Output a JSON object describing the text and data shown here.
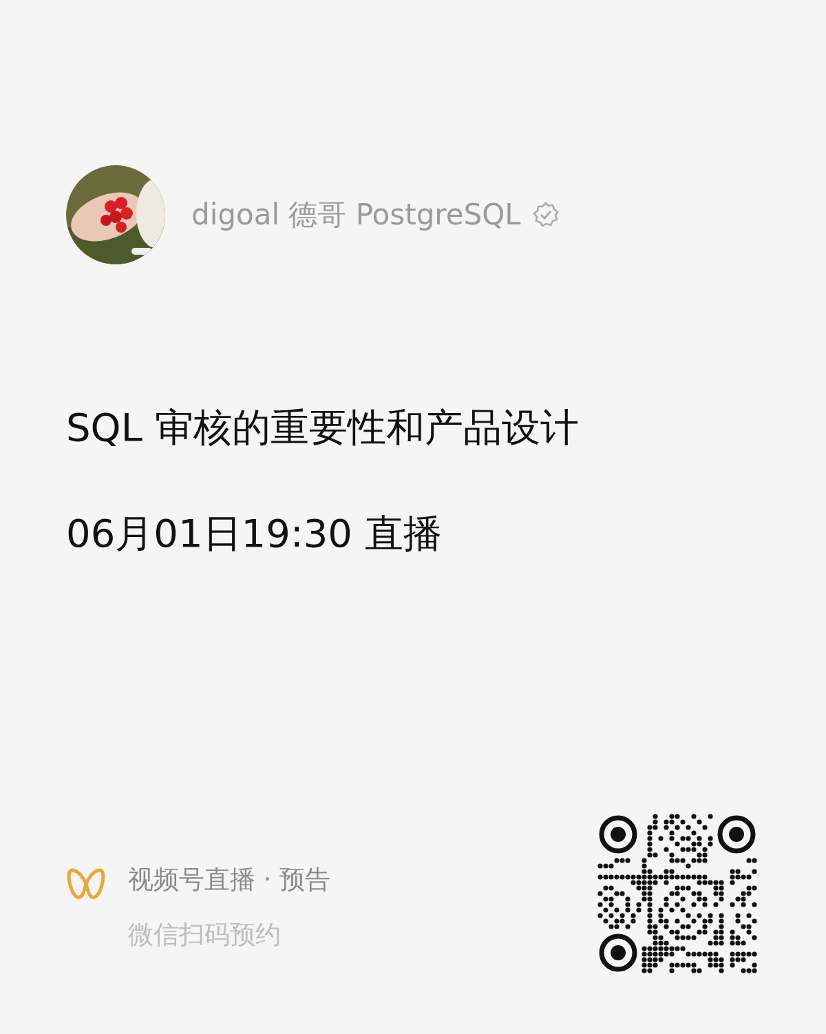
{
  "author": {
    "name": "digoal 德哥 PostgreSQL",
    "verified": true
  },
  "title": "SQL 审核的重要性和产品设计",
  "time": "06月01日19:30 直播",
  "footer": {
    "label": "视频号直播 · 预告",
    "hint": "微信扫码预约"
  }
}
